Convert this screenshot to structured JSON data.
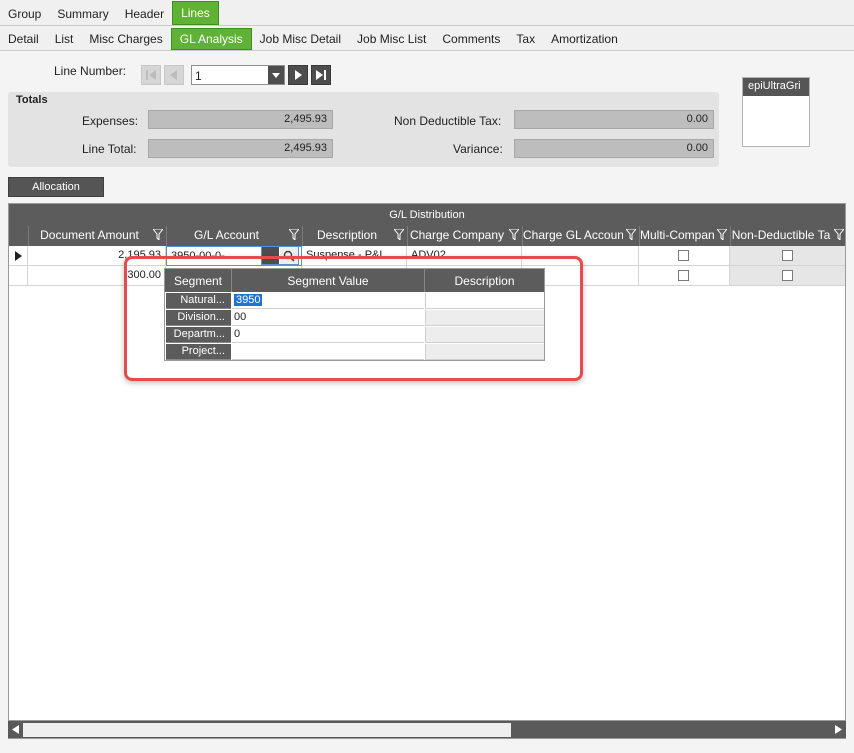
{
  "tabs_top": [
    "Group",
    "Summary",
    "Header",
    "Lines"
  ],
  "tabs_top_active": "Lines",
  "tabs_sub": [
    "Detail",
    "List",
    "Misc Charges",
    "GL Analysis",
    "Job Misc Detail",
    "Job Misc List",
    "Comments",
    "Tax",
    "Amortization"
  ],
  "tabs_sub_active": "GL Analysis",
  "line_number": {
    "label": "Line Number:",
    "value": "1"
  },
  "totals": {
    "title": "Totals",
    "expenses_label": "Expenses:",
    "expenses_value": "2,495.93",
    "line_total_label": "Line Total:",
    "line_total_value": "2,495.93",
    "non_deductible_tax_label": "Non Deductible Tax:",
    "non_deductible_tax_value": "0.00",
    "variance_label": "Variance:",
    "variance_value": "0.00"
  },
  "widget_title": "epiUltraGri",
  "allocation_button": "Allocation",
  "gl_grid": {
    "title": "G/L Distribution",
    "columns": [
      "Document Amount",
      "G/L Account",
      "Description",
      "Charge Company",
      "Charge GL Accoun",
      "Multi-Compan",
      "Non-Deductible Ta"
    ],
    "rows": [
      {
        "document_amount": "2,195.93",
        "gl_account": "3950-00-0-",
        "description": "Suspense - P&L",
        "charge_company": "ADV02",
        "multi_company": false,
        "non_deductible": false
      },
      {
        "document_amount": "300.00",
        "gl_account": "",
        "description": "",
        "charge_company": "",
        "multi_company": false,
        "non_deductible": false
      }
    ]
  },
  "segment_popup": {
    "headers": [
      "Segment",
      "Segment Value",
      "Description"
    ],
    "rows": [
      {
        "segment": "Natural...",
        "value": "3950",
        "description": ""
      },
      {
        "segment": "Division...",
        "value": "00",
        "description": ""
      },
      {
        "segment": "Departm...",
        "value": "0",
        "description": ""
      },
      {
        "segment": "Project...",
        "value": "",
        "description": ""
      }
    ]
  },
  "colors": {
    "active_tab": "#5fb236",
    "header_dark": "#5c5c5c",
    "highlight_box": "#e8494b",
    "selection": "#1e76d2"
  }
}
